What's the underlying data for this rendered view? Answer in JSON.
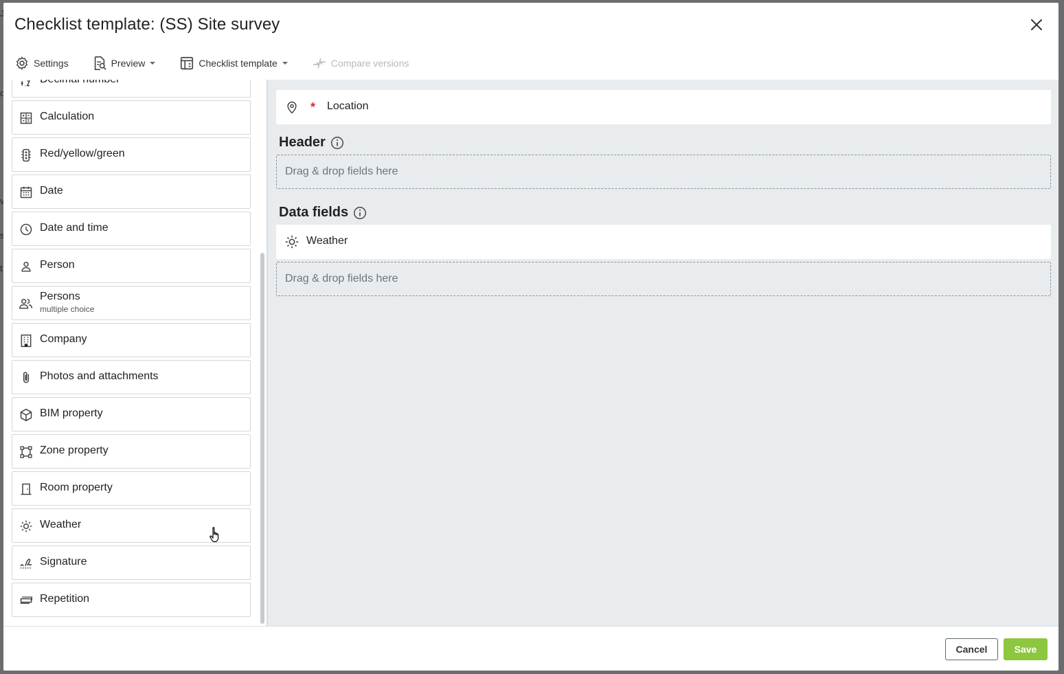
{
  "dialog": {
    "title": "Checklist template: (SS) Site survey"
  },
  "toolbar": {
    "settings_label": "Settings",
    "preview_label": "Preview",
    "checklist_template_label": "Checklist template",
    "compare_versions_label": "Compare versions"
  },
  "palette": {
    "items": [
      {
        "label": "Decimal number",
        "icon": "decimal-icon"
      },
      {
        "label": "Calculation",
        "icon": "calculator-icon"
      },
      {
        "label": "Red/yellow/green",
        "icon": "traffic-light-icon"
      },
      {
        "label": "Date",
        "icon": "calendar-icon"
      },
      {
        "label": "Date and time",
        "icon": "clock-icon"
      },
      {
        "label": "Person",
        "icon": "person-icon"
      },
      {
        "label": "Persons",
        "sublabel": "multiple choice",
        "icon": "persons-icon"
      },
      {
        "label": "Company",
        "icon": "building-icon"
      },
      {
        "label": "Photos and attachments",
        "icon": "paperclip-icon"
      },
      {
        "label": "BIM property",
        "icon": "cube-icon"
      },
      {
        "label": "Zone property",
        "icon": "zone-icon"
      },
      {
        "label": "Room property",
        "icon": "door-icon"
      },
      {
        "label": "Weather",
        "icon": "sun-icon"
      },
      {
        "label": "Signature",
        "icon": "signature-icon"
      },
      {
        "label": "Repetition",
        "icon": "repetition-icon"
      }
    ]
  },
  "canvas": {
    "location_label": "Location",
    "required_mark": "*",
    "header_title": "Header",
    "header_dropzone": "Drag & drop fields here",
    "data_fields_title": "Data fields",
    "weather_label": "Weather",
    "data_dropzone": "Drag & drop fields here"
  },
  "footer": {
    "cancel_label": "Cancel",
    "save_label": "Save"
  },
  "colors": {
    "save_button": "#8dc63f",
    "required": "#d32f2f",
    "canvas_bg": "#e9ecee"
  }
}
